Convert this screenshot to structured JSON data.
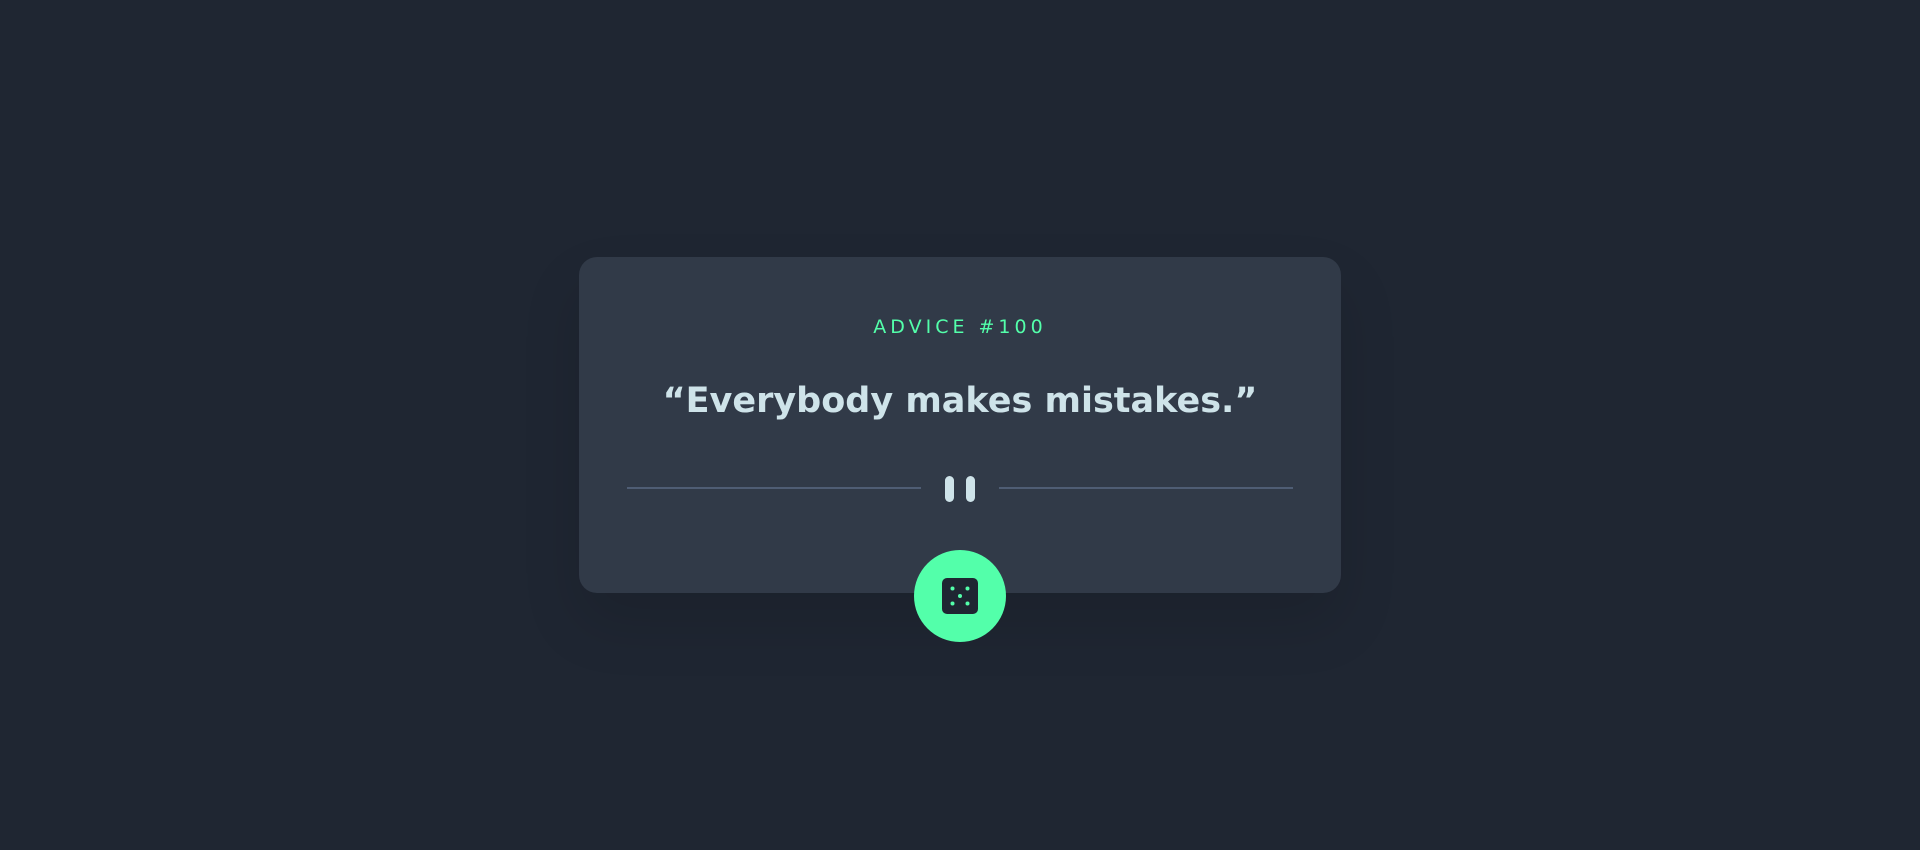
{
  "advice": {
    "label": "ADVICE #100",
    "quote": "“Everybody makes mistakes.”"
  },
  "divider": {
    "icon": "pause-icon"
  },
  "dice_button": {
    "icon": "dice-icon"
  },
  "colors": {
    "background": "#1f2632",
    "card": "#313a48",
    "accent": "#53ffaa",
    "text": "#cee3e9",
    "divider": "#4f5d74"
  }
}
